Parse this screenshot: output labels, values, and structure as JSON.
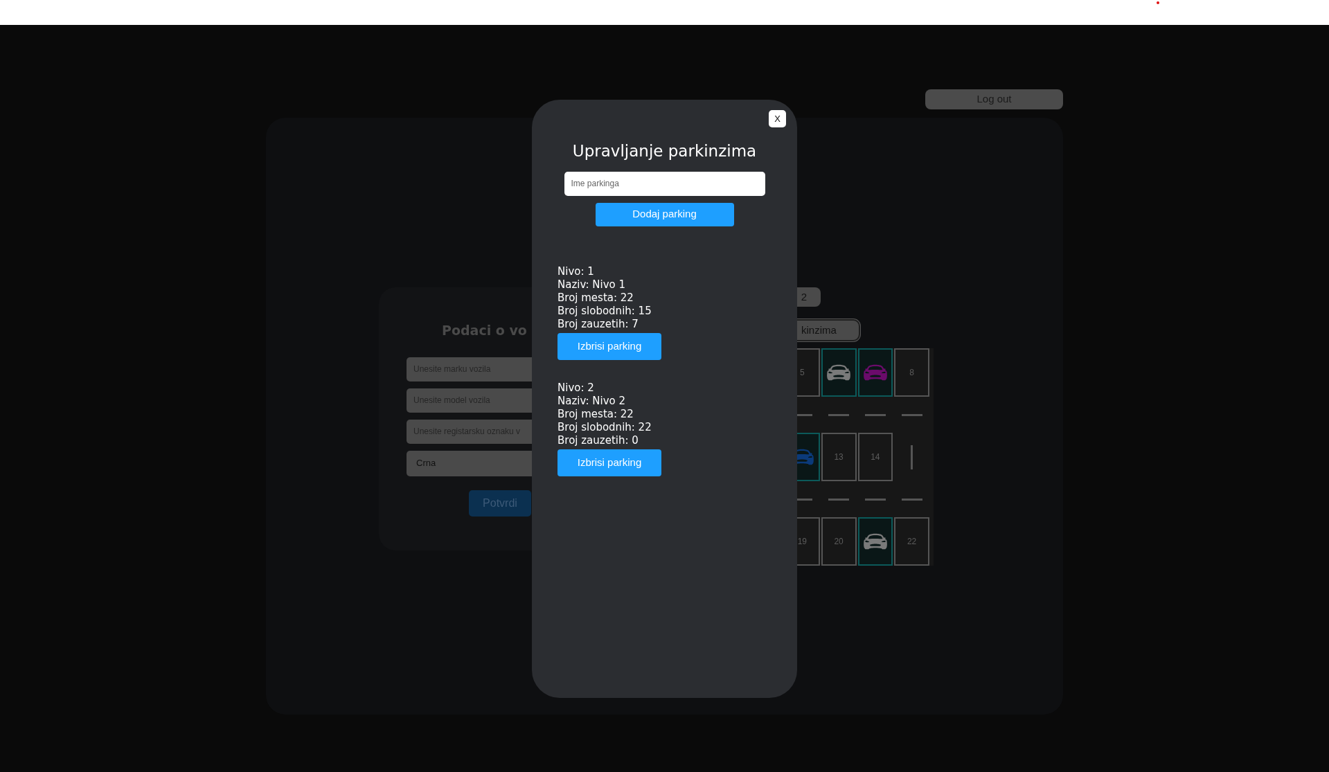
{
  "logout_button": "Log out",
  "vehicle_form": {
    "title": "Podaci o vo",
    "fields": [
      {
        "placeholder": "Unesite marku vozila"
      },
      {
        "placeholder": "Unesite model vozila"
      },
      {
        "placeholder": "Unesite registarsku oznaku v"
      },
      {
        "value": "Crna"
      }
    ],
    "submit": "Potvrdi"
  },
  "level_badge": "2",
  "manage_button": "kinzima",
  "parking_grid": {
    "rows": [
      [
        {
          "kind": "number",
          "label": "5"
        },
        {
          "kind": "car",
          "color": "#7a7a7a"
        },
        {
          "kind": "car",
          "color": "#6b0b6b"
        },
        {
          "kind": "number",
          "label": "8"
        }
      ],
      [
        {
          "kind": "car",
          "color": "#0b3a7a"
        },
        {
          "kind": "number",
          "label": "13"
        },
        {
          "kind": "number",
          "label": "14"
        },
        {
          "kind": "marker"
        }
      ],
      [
        {
          "kind": "number",
          "label": "19"
        },
        {
          "kind": "number",
          "label": "20"
        },
        {
          "kind": "car",
          "color": "#7a7a7a"
        },
        {
          "kind": "number",
          "label": "22"
        }
      ]
    ]
  },
  "modal": {
    "close": "X",
    "title": "Upravljanje parkinzima",
    "name_field": {
      "placeholder": "Ime parkinga"
    },
    "add_button": "Dodaj parking",
    "levels": [
      {
        "lines": [
          "Nivo: 1",
          "Naziv: Nivo 1",
          "Broj mesta: 22",
          "Broj slobodnih: 15",
          "Broj zauzetih: 7"
        ],
        "delete_button": "Izbrisi parking"
      },
      {
        "lines": [
          "Nivo: 2",
          "Naziv: Nivo 2",
          "Broj mesta: 22",
          "Broj slobodnih: 22",
          "Broj zauzetih: 0"
        ],
        "delete_button": "Izbrisi parking"
      }
    ]
  }
}
